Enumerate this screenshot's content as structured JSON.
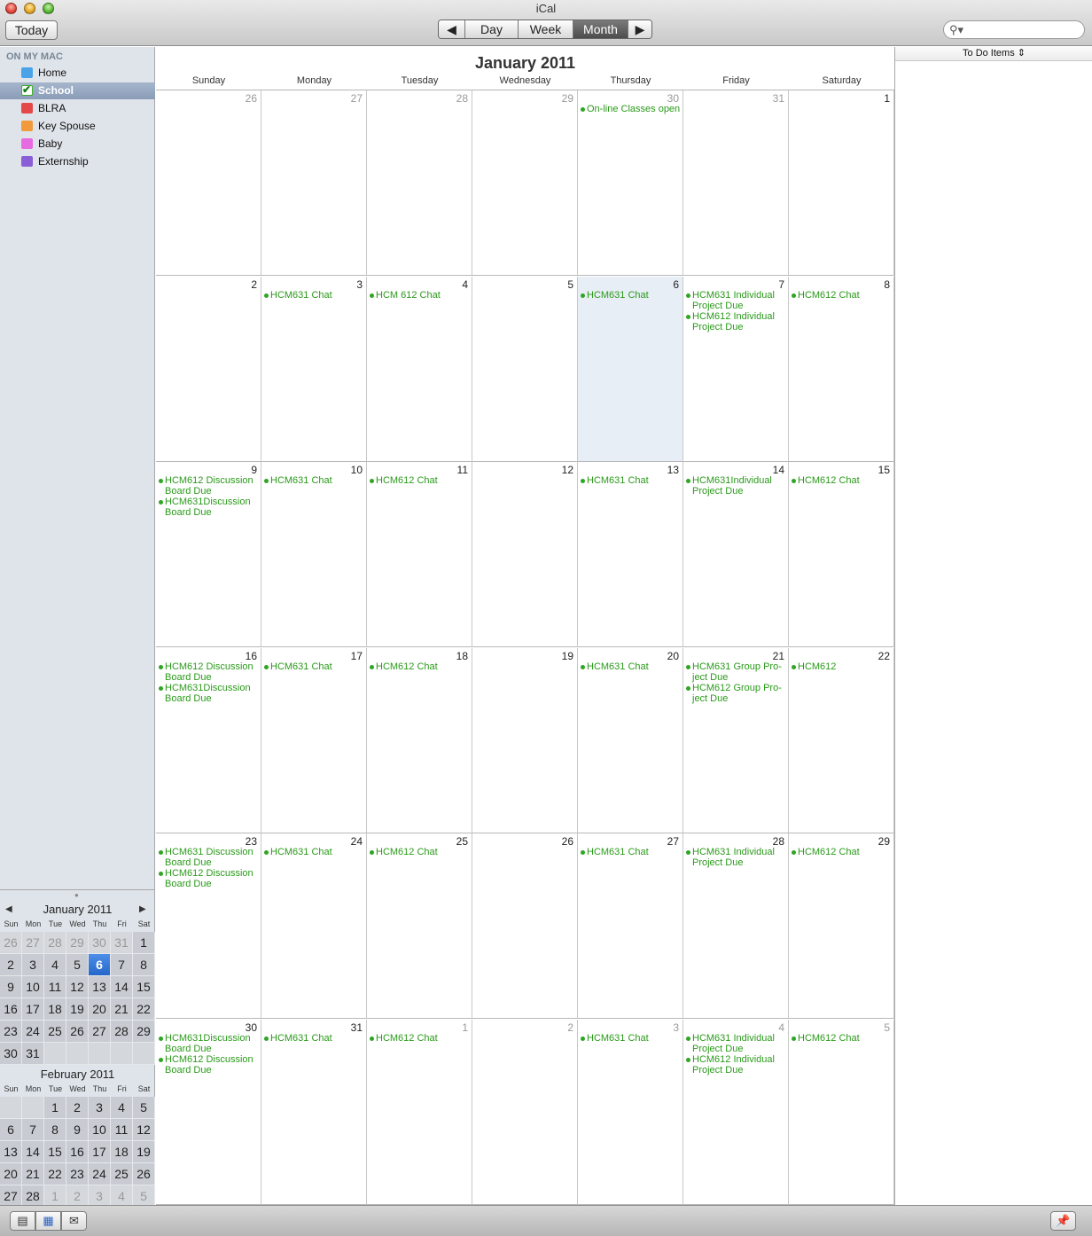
{
  "window": {
    "title": "iCal"
  },
  "toolbar": {
    "today_label": "Today",
    "views": [
      {
        "label": "◀"
      },
      {
        "label": "Day"
      },
      {
        "label": "Week"
      },
      {
        "label": "Month",
        "active": true
      },
      {
        "label": "▶"
      }
    ],
    "search_placeholder": ""
  },
  "sidebar": {
    "header": "ON MY MAC",
    "calendars": [
      {
        "label": "Home",
        "color": "#4aa3e8"
      },
      {
        "label": "School",
        "color": "#3dae2a",
        "selected": true,
        "checked": true
      },
      {
        "label": "BLRA",
        "color": "#e54848"
      },
      {
        "label": "Key Spouse",
        "color": "#f29a3b"
      },
      {
        "label": "Baby",
        "color": "#e66ae0"
      },
      {
        "label": "Externship",
        "color": "#8a5ed6"
      }
    ]
  },
  "mini_calendars": [
    {
      "title": "January 2011",
      "dow": [
        "Sun",
        "Mon",
        "Tue",
        "Wed",
        "Thu",
        "Fri",
        "Sat"
      ],
      "weeks": [
        [
          "26",
          "27",
          "28",
          "29",
          "30",
          "31",
          "1"
        ],
        [
          "2",
          "3",
          "4",
          "5",
          "6",
          "7",
          "8"
        ],
        [
          "9",
          "10",
          "11",
          "12",
          "13",
          "14",
          "15"
        ],
        [
          "16",
          "17",
          "18",
          "19",
          "20",
          "21",
          "22"
        ],
        [
          "23",
          "24",
          "25",
          "26",
          "27",
          "28",
          "29"
        ],
        [
          "30",
          "31",
          "",
          "",
          "",
          "",
          ""
        ]
      ],
      "dim": [
        [
          0,
          0
        ],
        [
          0,
          1
        ],
        [
          0,
          2
        ],
        [
          0,
          3
        ],
        [
          0,
          4
        ],
        [
          0,
          5
        ]
      ],
      "today": [
        1,
        4
      ]
    },
    {
      "title": "February 2011",
      "dow": [
        "Sun",
        "Mon",
        "Tue",
        "Wed",
        "Thu",
        "Fri",
        "Sat"
      ],
      "weeks": [
        [
          "",
          "",
          "1",
          "2",
          "3",
          "4",
          "5"
        ],
        [
          "6",
          "7",
          "8",
          "9",
          "10",
          "11",
          "12"
        ],
        [
          "13",
          "14",
          "15",
          "16",
          "17",
          "18",
          "19"
        ],
        [
          "20",
          "21",
          "22",
          "23",
          "24",
          "25",
          "26"
        ],
        [
          "27",
          "28",
          "1",
          "2",
          "3",
          "4",
          "5"
        ]
      ],
      "dim": [
        [
          4,
          2
        ],
        [
          4,
          3
        ],
        [
          4,
          4
        ],
        [
          4,
          5
        ],
        [
          4,
          6
        ]
      ]
    }
  ],
  "month_view": {
    "title": "January 2011",
    "days_of_week": [
      "Sunday",
      "Monday",
      "Tuesday",
      "Wednesday",
      "Thursday",
      "Friday",
      "Saturday"
    ],
    "weeks": [
      [
        {
          "num": "26",
          "other": true,
          "events": []
        },
        {
          "num": "27",
          "other": true,
          "events": []
        },
        {
          "num": "28",
          "other": true,
          "events": []
        },
        {
          "num": "29",
          "other": true,
          "events": []
        },
        {
          "num": "30",
          "other": true,
          "events": [
            "On-line Classes open"
          ]
        },
        {
          "num": "31",
          "other": true,
          "events": []
        },
        {
          "num": "1",
          "events": []
        }
      ],
      [
        {
          "num": "2",
          "events": []
        },
        {
          "num": "3",
          "events": [
            "HCM631 Chat"
          ]
        },
        {
          "num": "4",
          "events": [
            "HCM 612 Chat"
          ]
        },
        {
          "num": "5",
          "events": []
        },
        {
          "num": "6",
          "selected": true,
          "events": [
            "HCM631 Chat"
          ]
        },
        {
          "num": "7",
          "events": [
            "HCM631 Individual Project Due",
            "HCM612 Individual Project Due"
          ]
        },
        {
          "num": "8",
          "events": [
            "HCM612 Chat"
          ]
        }
      ],
      [
        {
          "num": "9",
          "events": [
            "HCM612 Discussion Board Due",
            "HCM631Discussion Board Due"
          ]
        },
        {
          "num": "10",
          "events": [
            "HCM631 Chat"
          ]
        },
        {
          "num": "11",
          "events": [
            "HCM612 Chat"
          ]
        },
        {
          "num": "12",
          "events": []
        },
        {
          "num": "13",
          "events": [
            "HCM631 Chat"
          ]
        },
        {
          "num": "14",
          "events": [
            "HCM631Individual Project Due"
          ]
        },
        {
          "num": "15",
          "events": [
            "HCM612 Chat"
          ]
        }
      ],
      [
        {
          "num": "16",
          "events": [
            "HCM612 Discussion Board Due",
            "HCM631Discussion Board Due"
          ]
        },
        {
          "num": "17",
          "events": [
            "HCM631 Chat"
          ]
        },
        {
          "num": "18",
          "events": [
            "HCM612 Chat"
          ]
        },
        {
          "num": "19",
          "events": []
        },
        {
          "num": "20",
          "events": [
            "HCM631 Chat"
          ]
        },
        {
          "num": "21",
          "events": [
            "HCM631 Group Pro-ject Due",
            "HCM612 Group Pro-ject Due"
          ]
        },
        {
          "num": "22",
          "events": [
            "HCM612"
          ]
        }
      ],
      [
        {
          "num": "23",
          "events": [
            "HCM631 Discussion Board Due",
            "HCM612 Discussion Board Due"
          ]
        },
        {
          "num": "24",
          "events": [
            "HCM631 Chat"
          ]
        },
        {
          "num": "25",
          "events": [
            "HCM612 Chat"
          ]
        },
        {
          "num": "26",
          "events": []
        },
        {
          "num": "27",
          "events": [
            "HCM631 Chat"
          ]
        },
        {
          "num": "28",
          "events": [
            "HCM631 Individual Project Due"
          ]
        },
        {
          "num": "29",
          "events": [
            "HCM612 Chat"
          ]
        }
      ],
      [
        {
          "num": "30",
          "events": [
            "HCM631Discussion Board Due",
            "HCM612 Discussion Board Due"
          ]
        },
        {
          "num": "31",
          "events": [
            "HCM631 Chat"
          ]
        },
        {
          "num": "1",
          "other": true,
          "events": [
            "HCM612 Chat"
          ]
        },
        {
          "num": "2",
          "other": true,
          "events": []
        },
        {
          "num": "3",
          "other": true,
          "events": [
            "HCM631 Chat"
          ]
        },
        {
          "num": "4",
          "other": true,
          "events": [
            "HCM631 Individual Project Due",
            "HCM612 Individual Project Due"
          ]
        },
        {
          "num": "5",
          "other": true,
          "events": [
            "HCM612 Chat"
          ]
        }
      ]
    ]
  },
  "todo": {
    "header": "To Do Items ⇕"
  },
  "bottom_bar": {
    "buttons": [
      {
        "icon": "calendar-list-icon"
      },
      {
        "icon": "mini-calendar-icon"
      },
      {
        "icon": "notifications-icon"
      },
      {
        "icon": "pin-icon"
      }
    ]
  }
}
